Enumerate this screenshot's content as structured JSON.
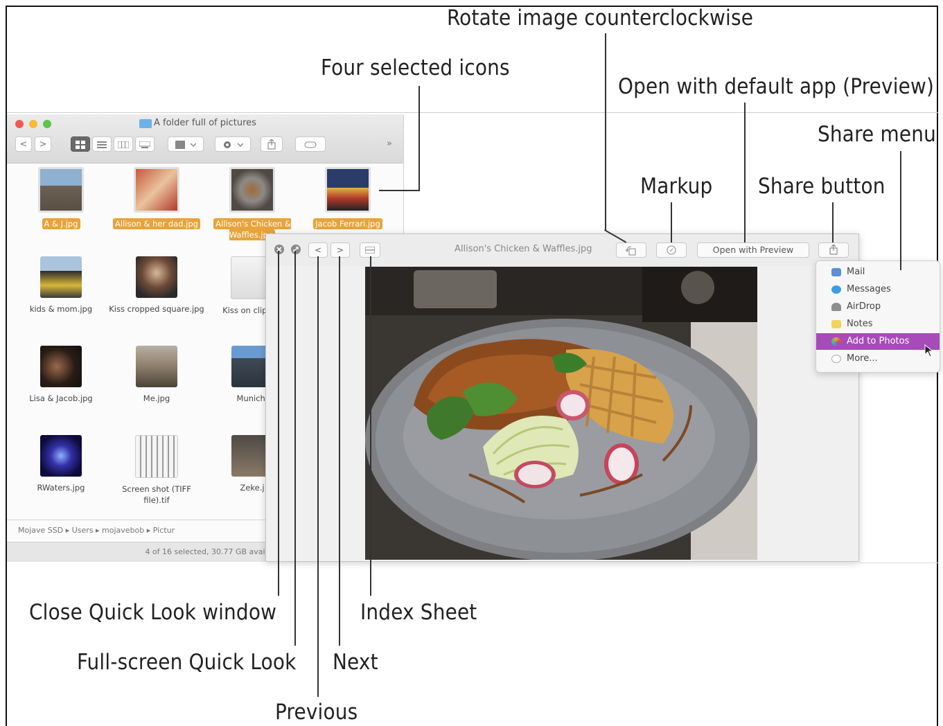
{
  "callouts": {
    "rotate": "Rotate image counterclockwise",
    "four_selected": "Four selected icons",
    "open_default": "Open with default app (Preview)",
    "share_menu": "Share menu",
    "markup": "Markup",
    "share_button": "Share button",
    "close_quick_look": "Close Quick Look window",
    "full_screen": "Full-screen Quick Look",
    "previous": "Previous",
    "index_sheet": "Index Sheet",
    "next": "Next"
  },
  "finder": {
    "title": "A folder full of pictures",
    "toolbar": {
      "back": "<",
      "forward": ">",
      "more": "»"
    },
    "files": [
      {
        "name": "A & J.jpg",
        "selected": true
      },
      {
        "name": "Allison & her dad.jpg",
        "selected": true
      },
      {
        "name": "Allison's Chicken & Waffles.jpg",
        "selected": true
      },
      {
        "name": "Jacob Ferrari.jpg",
        "selected": true
      },
      {
        "name": "kids & mom.jpg",
        "selected": false
      },
      {
        "name": "Kiss cropped square.jpg",
        "selected": false
      },
      {
        "name": "Kiss on clipboa",
        "selected": false
      },
      {
        "name": "Lisa & Jacob.jpg",
        "selected": false
      },
      {
        "name": "Me.jpg",
        "selected": false
      },
      {
        "name": "Munich,",
        "selected": false
      },
      {
        "name": "RWaters.jpg",
        "selected": false
      },
      {
        "name": "Screen shot (TIFF file).tif",
        "selected": false
      },
      {
        "name": "Zeke.j",
        "selected": false
      }
    ],
    "path": "Mojave SSD  ▸  Users  ▸  mojavebob  ▸  Pictur",
    "status": "4 of 16 selected, 30.77 GB avai"
  },
  "quicklook": {
    "title": "Allison's Chicken & Waffles.jpg",
    "open_with": "Open with Preview",
    "back": "<",
    "forward": ">"
  },
  "share_menu": {
    "items": [
      {
        "label": "Mail",
        "icon": "mail-icon",
        "color": "#5b8fd6"
      },
      {
        "label": "Messages",
        "icon": "messages-icon",
        "color": "#3d9be9"
      },
      {
        "label": "AirDrop",
        "icon": "airdrop-icon",
        "color": "#8e8e8e"
      },
      {
        "label": "Notes",
        "icon": "notes-icon",
        "color": "#f2d45c"
      },
      {
        "label": "Add to Photos",
        "icon": "photos-icon",
        "color": "#f0a23b",
        "highlighted": true
      },
      {
        "label": "More...",
        "icon": "more-icon",
        "color": "#bdbdbd"
      }
    ]
  },
  "colors": {
    "selection": "#e8a33a",
    "menu_highlight": "#a64bb8"
  }
}
